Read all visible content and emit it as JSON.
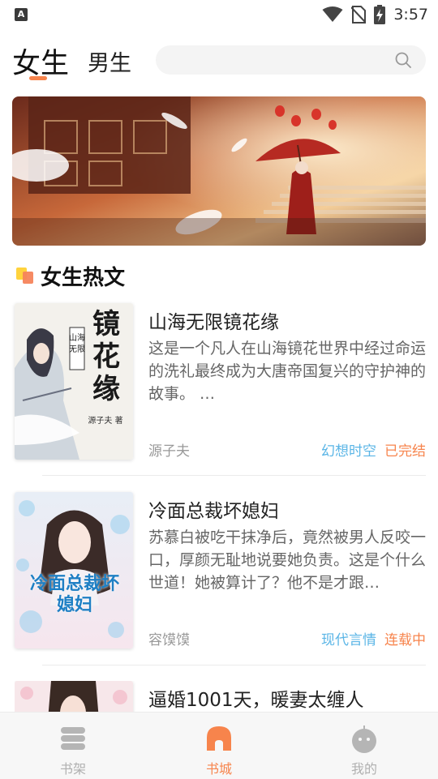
{
  "status_bar": {
    "time": "3:57",
    "app_icon_letter": "A"
  },
  "header": {
    "tabs": [
      {
        "label": "女生",
        "active": true
      },
      {
        "label": "男生",
        "active": false
      }
    ],
    "search": {
      "placeholder": "",
      "icon": "search-icon"
    }
  },
  "section": {
    "title": "女生热文"
  },
  "books": [
    {
      "title": "山海无限镜花缘",
      "description": "这是一个凡人在山海镜花世界中经过命运的洗礼最终成为大唐帝国复兴的守护神的故事。 …",
      "author": "源子夫",
      "genre": "幻想时空",
      "status": "已完结",
      "cover_title": "镜花缘",
      "cover_subtitle": "山海无限",
      "cover_author": "源子夫 著"
    },
    {
      "title": "冷面总裁坏媳妇",
      "description": "苏慕白被吃干抹净后，竟然被男人反咬一口，厚颜无耻地说要她负责。这是个什么世道！她被算计了？他不是才跟…",
      "author": "容馍馍",
      "genre": "现代言情",
      "status": "连载中",
      "cover_title": "冷面总裁坏媳妇"
    },
    {
      "title": "逼婚1001天，暖妻太缠人"
    }
  ],
  "bottom_nav": [
    {
      "label": "书架",
      "icon": "bookshelf-icon",
      "active": false
    },
    {
      "label": "书城",
      "icon": "bookstore-icon",
      "active": true
    },
    {
      "label": "我的",
      "icon": "profile-icon",
      "active": false
    }
  ],
  "colors": {
    "accent": "#f7844c",
    "genre": "#5ab5e6",
    "inactive": "#b5b5b5"
  }
}
